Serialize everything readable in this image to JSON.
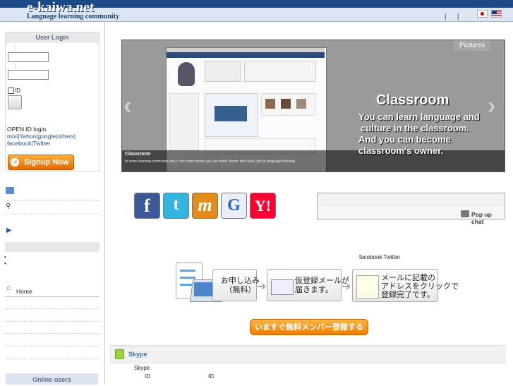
{
  "header": {
    "logo": "e-kaiwa.net",
    "tagline": "Language learning community",
    "sep1": "|",
    "sep2": "|"
  },
  "login": {
    "title": "User Login",
    "label1": ":",
    "label2": ":",
    "remember_label": "ID",
    "openid_title": "OPEN ID login",
    "openid_links1": "mixi|Yahoo|google|others|",
    "openid_links2": "facebook|Twitter",
    "signup_label": "Signup Now !"
  },
  "sidebar": {
    "home_label": "Home",
    "online_users": "Online users"
  },
  "banner": {
    "pictures_tab": "Pictures",
    "caption_title": "Classroom",
    "caption_text": "In some learning community this is the room where you can make lesson and class, join in language learning.",
    "heading": "Classroom",
    "lines": [
      "You can learn language and",
      "culture in the classroom.",
      "And you can become",
      "classroom's owner."
    ]
  },
  "social": [
    {
      "name": "facebook",
      "glyph": "f",
      "color": "#3b5998"
    },
    {
      "name": "twitter",
      "glyph": "t",
      "color": "#34b4e0"
    },
    {
      "name": "mixi",
      "glyph": "m",
      "color": "#e38c1b"
    },
    {
      "name": "google",
      "glyph": "G",
      "color": "#e9eef7"
    },
    {
      "name": "yahoo",
      "glyph": "Y!",
      "color": "#ff0033"
    }
  ],
  "chat": {
    "label": "Pop up chat"
  },
  "login_links_text": "facebook Twitter",
  "flow": {
    "step1": "お申し込み\n（無料）",
    "step2": "仮登録メールが\n届きます。",
    "step3": "メールに記載の\nアドレスをクリックで\n登録完了です。",
    "register_button": "いますぐ無料メンバー登録する"
  },
  "skype": {
    "title": "Skype",
    "line1": "Skype",
    "id_label_1": "ID",
    "id_label_2": "ID"
  }
}
